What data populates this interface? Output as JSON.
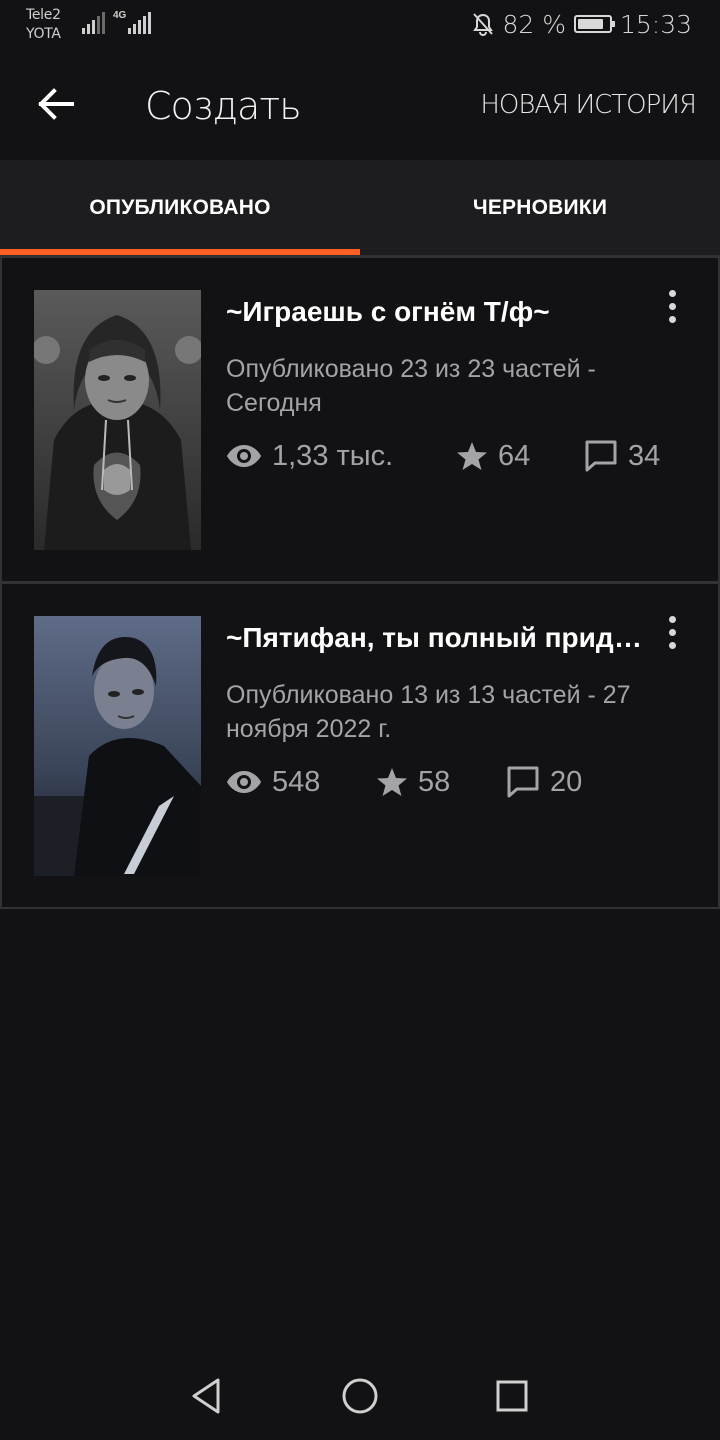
{
  "status_bar": {
    "carrier_1": "Tele2",
    "carrier_2": "YOTA",
    "network": "4G",
    "battery": "82 %",
    "battery_level": 0.82,
    "time": "15:33",
    "icons": [
      "signal-icon",
      "mute-icon",
      "battery-icon"
    ]
  },
  "header": {
    "title": "Создать",
    "new_story": "НОВАЯ ИСТОРИЯ",
    "back_icon": "arrow-left-icon"
  },
  "tabs": [
    {
      "label": "ОПУБЛИКОВАНО",
      "active": true
    },
    {
      "label": "ЧЕРНОВИКИ",
      "active": false
    }
  ],
  "accent_color": "#ff6122",
  "stories": [
    {
      "title": "~Играешь с огнём Т/ф~",
      "meta": "Опубликовано 23 из 23 частей - Сегодня",
      "views": "1,33 тыс.",
      "votes": "64",
      "comments": "34"
    },
    {
      "title": "~Пятифан, ты полный придурок~",
      "meta": "Опубликовано 13 из 13 частей - 27 ноября 2022 г.",
      "views": "548",
      "votes": "58",
      "comments": "20"
    }
  ],
  "nav_bar": {
    "icons": [
      "back-triangle-icon",
      "home-circle-icon",
      "recents-square-icon"
    ]
  }
}
